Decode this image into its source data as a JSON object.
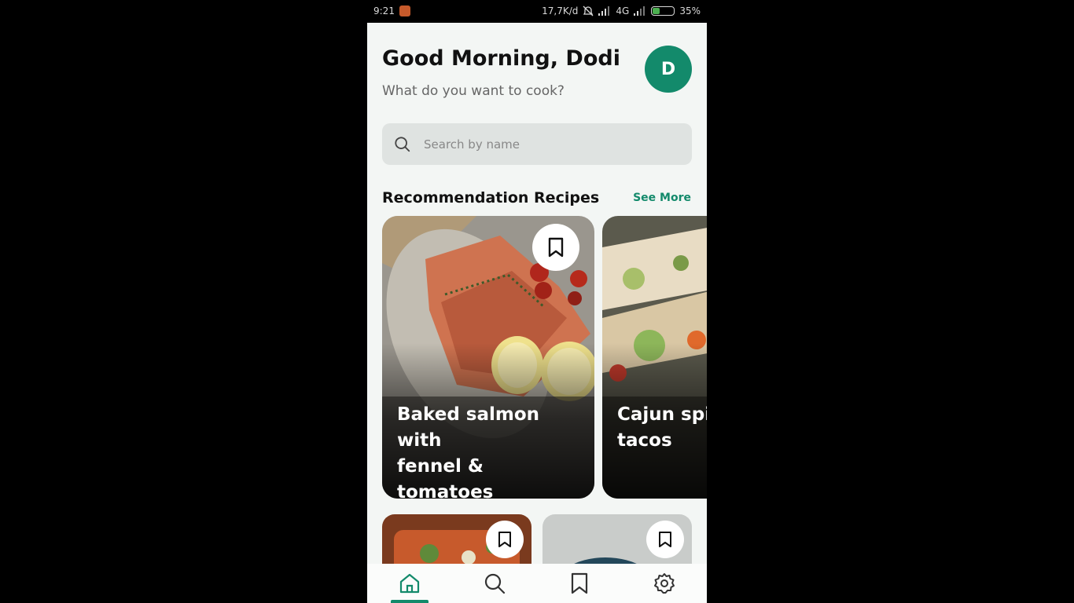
{
  "status_bar": {
    "time": "9:21",
    "speed": "17,7K/d",
    "network": "4G",
    "battery": "35%",
    "battery_level": 0.35
  },
  "header": {
    "greeting": "Good Morning, Dodi",
    "subtitle": "What do you want to cook?",
    "avatar_initial": "D"
  },
  "search": {
    "placeholder": "Search by name",
    "value": ""
  },
  "recommendation": {
    "title": "Recommendation Recipes",
    "see_more": "See More",
    "cards": [
      {
        "title": "Baked salmon with\nfennel & tomatoes"
      },
      {
        "title": "Cajun spi\ntacos"
      }
    ]
  },
  "bottom_nav": {
    "items": [
      "home-icon",
      "search-icon",
      "bookmark-icon",
      "settings-icon"
    ],
    "active": "home-icon"
  },
  "colors": {
    "accent": "#138a6b",
    "background": "#f3f6f4"
  }
}
